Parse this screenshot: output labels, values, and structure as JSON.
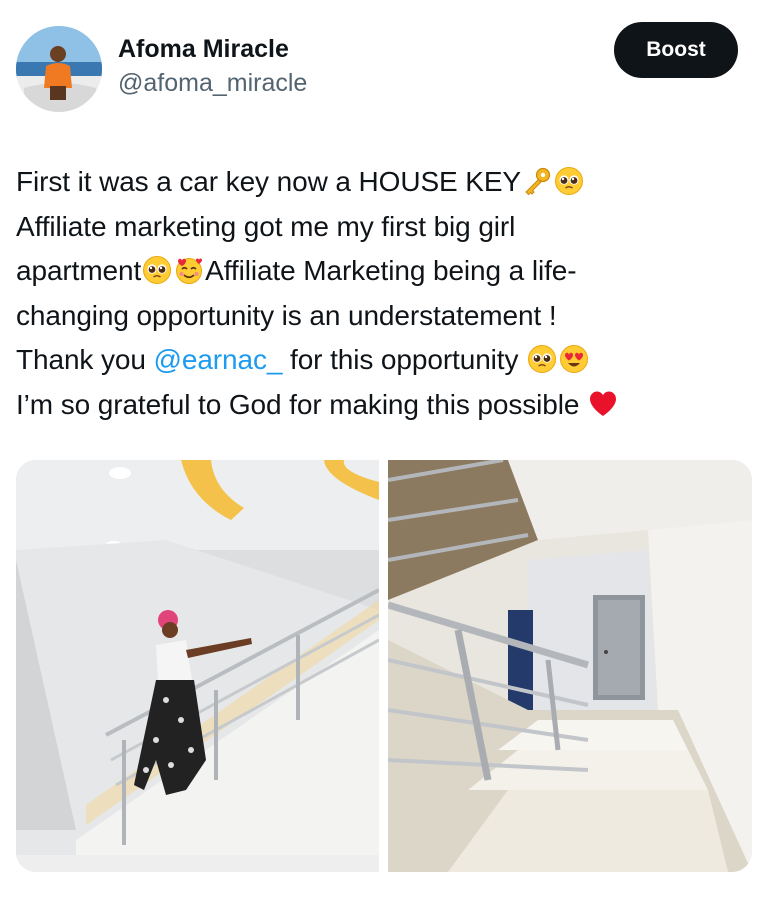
{
  "author": {
    "display_name": "Afoma Miracle",
    "handle": "@afoma_miracle",
    "avatar_icon": "profile-photo"
  },
  "actions": {
    "boost_label": "Boost"
  },
  "tweet": {
    "line1_text": "First it was a car key now a HOUSE KEY",
    "line1_emojis": [
      "key-emoji",
      "pleading-face-emoji"
    ],
    "line2_text": "Affiliate marketing got me my first big girl",
    "line3_text_a": "apartment",
    "line3_emojis": [
      "pleading-face-emoji",
      "smiling-face-with-hearts-emoji"
    ],
    "line3_text_b": "Affiliate Marketing being a life-",
    "line4_text": "changing opportunity is an understatement !",
    "line5_text_a": "Thank you ",
    "line5_mention": "@earnac_",
    "line5_text_b": " for this opportunity ",
    "line5_emojis": [
      "pleading-face-emoji",
      "heart-eyes-emoji"
    ],
    "line6_text": "I’m so grateful to God for making this possible ",
    "line6_emojis": [
      "red-heart-emoji"
    ]
  },
  "media": {
    "photos": [
      "woman-on-staircase-photo",
      "staircase-with-railing-photo"
    ]
  },
  "colors": {
    "text_primary": "#0f1419",
    "text_secondary": "#536471",
    "mention_blue": "#1d9bf0",
    "button_dark": "#0f1419"
  }
}
